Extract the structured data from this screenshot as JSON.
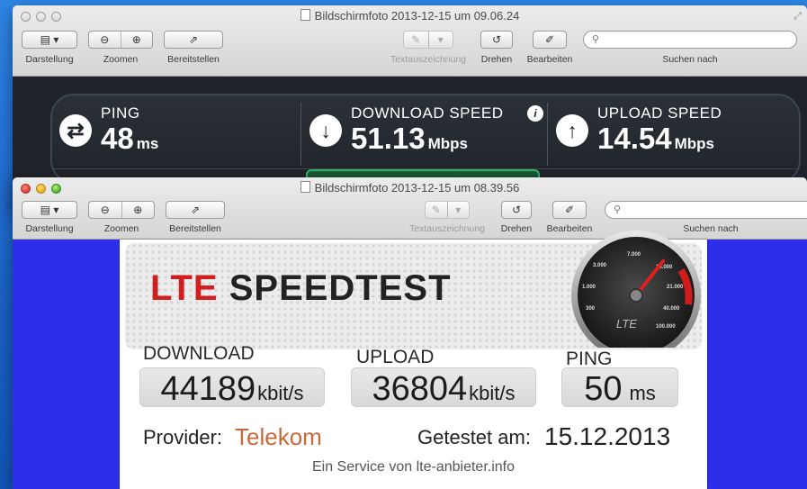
{
  "window_back": {
    "title": "Bildschirmfoto 2013-12-15 um 09.06.24",
    "toolbar": {
      "view_label": "Darstellung",
      "zoom_label": "Zoomen",
      "share_label": "Bereitstellen",
      "annotate_label": "Textauszeichnung",
      "rotate_label": "Drehen",
      "edit_label": "Bearbeiten",
      "search_label": "Suchen nach"
    },
    "speedtest": {
      "ping_label": "PING",
      "ping_value": "48",
      "ping_unit": "ms",
      "download_label": "DOWNLOAD SPEED",
      "download_value": "51.13",
      "download_unit": "Mbps",
      "upload_label": "UPLOAD SPEED",
      "upload_value": "14.54",
      "upload_unit": "Mbps"
    }
  },
  "window_front": {
    "title": "Bildschirmfoto 2013-12-15 um 08.39.56",
    "toolbar": {
      "view_label": "Darstellung",
      "zoom_label": "Zoomen",
      "share_label": "Bereitstellen",
      "annotate_label": "Textauszeichnung",
      "rotate_label": "Drehen",
      "edit_label": "Bearbeiten",
      "search_label": "Suchen nach"
    },
    "lte": {
      "title_red": "LTE",
      "title_rest": "SPEEDTEST",
      "gauge_label": "LTE",
      "gauge_ticks": [
        "3.000",
        "7.000",
        "14.000",
        "21.000",
        "40.000",
        "100.000",
        "1.000",
        "300"
      ],
      "download_label": "DOWNLOAD",
      "download_value": "44189",
      "download_unit": "kbit/s",
      "upload_label": "UPLOAD",
      "upload_value": "36804",
      "upload_unit": "kbit/s",
      "ping_label": "PING",
      "ping_value": "50",
      "ping_unit": "ms",
      "provider_label": "Provider:",
      "provider_value": "Telekom",
      "tested_label": "Getestet am:",
      "tested_value": "15.12.2013",
      "footer": "Ein Service von lte-anbieter.info"
    }
  },
  "colors": {
    "desktop": "#1a63c9",
    "front_content_bg": "#2d2eea",
    "lte_red": "#d11f1f",
    "provider_orange": "#c46a3a",
    "ookla_dark": "#1f2429",
    "ookla_green": "#35b26a"
  },
  "icons": {
    "ping": "exchange-arrows-icon",
    "download": "arrow-down-icon",
    "upload": "arrow-up-icon",
    "info": "info-icon",
    "search": "magnifier-icon",
    "zoom_out": "zoom-out-icon",
    "zoom_in": "zoom-in-icon",
    "share": "share-icon",
    "rotate": "rotate-icon",
    "edit": "pencil-icon",
    "view": "sidebar-view-icon"
  }
}
